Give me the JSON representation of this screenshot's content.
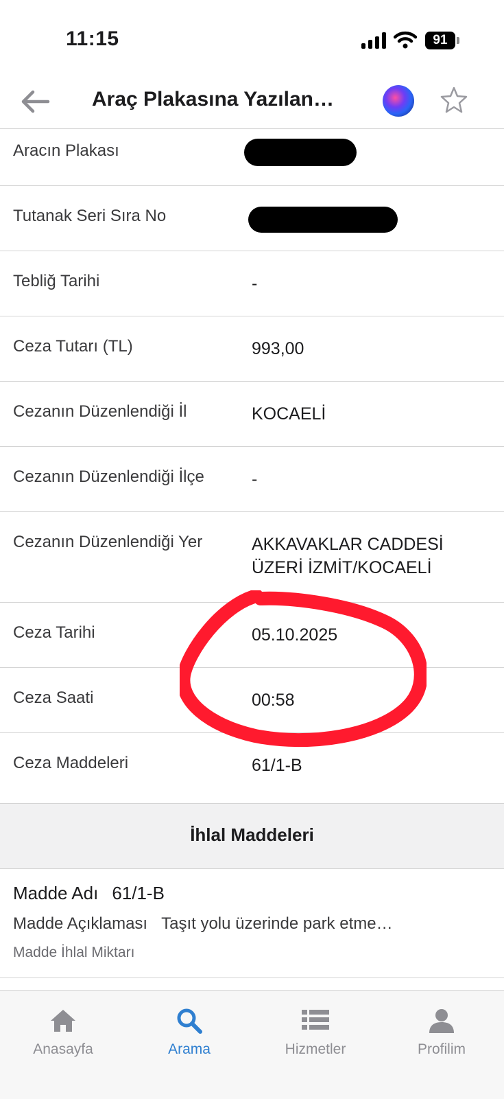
{
  "status_bar": {
    "time": "11:15",
    "battery": "91"
  },
  "nav": {
    "title": "Araç Plakasına Yazılan…"
  },
  "details": [
    {
      "label": "Aracın Plakası",
      "value": ""
    },
    {
      "label": "Tutanak Seri Sıra No",
      "value": ""
    },
    {
      "label": "Tebliğ Tarihi",
      "value": "-"
    },
    {
      "label": "Ceza Tutarı (TL)",
      "value": "993,00"
    },
    {
      "label": "Cezanın Düzenlendiği İl",
      "value": "KOCAELİ"
    },
    {
      "label": "Cezanın Düzenlendiği İlçe",
      "value": "-"
    },
    {
      "label": "Cezanın Düzenlendiği Yer",
      "value_line1": "AKKAVAKLAR CADDESİ",
      "value_line2": "ÜZERİ İZMİT/KOCAELİ"
    },
    {
      "label": "Ceza Tarihi",
      "value": "05.10.2025"
    },
    {
      "label": "Ceza Saati",
      "value": "00:58"
    },
    {
      "label": "Ceza Maddeleri",
      "value": "61/1-B"
    }
  ],
  "section": {
    "title": "İhlal Maddeleri"
  },
  "violation_item": {
    "name_label": "Madde Adı",
    "name_value": "61/1-B",
    "desc_label": "Madde Açıklaması",
    "desc_value": "Taşıt yolu üzerinde park etme…",
    "amount_label": "Madde İhlal Miktarı"
  },
  "tabs": [
    {
      "label": "Anasayfa",
      "icon": "home-icon",
      "active": false
    },
    {
      "label": "Arama",
      "icon": "search-icon",
      "active": true
    },
    {
      "label": "Hizmetler",
      "icon": "list-icon",
      "active": false
    },
    {
      "label": "Profilim",
      "icon": "person-icon",
      "active": false
    }
  ],
  "colors": {
    "accent": "#2f7fd0",
    "annotation": "#ff1a2e",
    "tab_inactive": "#8e8e93"
  }
}
